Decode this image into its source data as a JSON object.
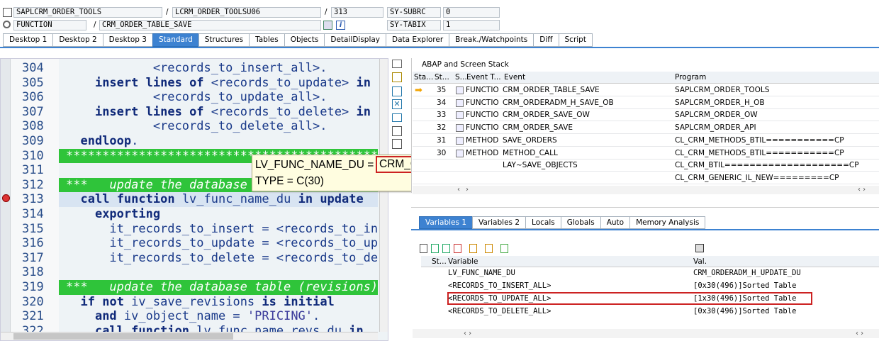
{
  "header": {
    "program_field": "SAPLCRM_ORDER_TOOLS",
    "include_sep": "/",
    "include_field": "LCRM_ORDER_TOOLSU06",
    "line_sep": "/",
    "line_field": "313",
    "sysvar1_label": "SY-SUBRC",
    "sysvar1_value": "0",
    "event_type": "FUNCTION",
    "event_sep": "/",
    "event_name": "CRM_ORDER_TABLE_SAVE",
    "sysvar2_label": "SY-TABIX",
    "sysvar2_value": "1"
  },
  "tabs": [
    "Desktop 1",
    "Desktop 2",
    "Desktop 3",
    "Standard",
    "Structures",
    "Tables",
    "Objects",
    "DetailDisplay",
    "Data Explorer",
    "Break./Watchpoints",
    "Diff",
    "Script"
  ],
  "active_tab": "Standard",
  "editor": {
    "lines": [
      {
        "n": "304",
        "text": "            <records_to_insert_all>."
      },
      {
        "n": "305",
        "text": "    insert lines of <records_to_update> in"
      },
      {
        "n": "306",
        "text": "            <records_to_update_all>."
      },
      {
        "n": "307",
        "text": "    insert lines of <records_to_delete> in"
      },
      {
        "n": "308",
        "text": "            <records_to_delete_all>."
      },
      {
        "n": "309",
        "text": "  endloop."
      },
      {
        "n": "310",
        "text": "*******************************************"
      },
      {
        "n": "311",
        "text": ""
      },
      {
        "n": "312",
        "text": "***   update the database"
      },
      {
        "n": "313",
        "text": "  call function lv_func_name_du in update"
      },
      {
        "n": "314",
        "text": "    exporting"
      },
      {
        "n": "315",
        "text": "      it_records_to_insert = <records_to_in"
      },
      {
        "n": "316",
        "text": "      it_records_to_update = <records_to_up"
      },
      {
        "n": "317",
        "text": "      it_records_to_delete = <records_to_de"
      },
      {
        "n": "318",
        "text": ""
      },
      {
        "n": "319",
        "text": "***   update the database table (revisions)"
      },
      {
        "n": "320",
        "text": "  if not iv_save_revisions is initial"
      },
      {
        "n": "321",
        "text": "    and iv_object_name = 'PRICING'."
      },
      {
        "n": "322",
        "text": "    call function lv_func_name_revs_du in"
      }
    ],
    "tooltip_line1": "LV_FUNC_NAME_DU = ",
    "tooltip_value": "CRM_ORDERADM_H_UPDATE_DU",
    "tooltip_line2": "TYPE  = C(30)"
  },
  "stack": {
    "title": "ABAP and Screen Stack",
    "headers": [
      "Sta...",
      "St...",
      "S...",
      "Event T...",
      "Event",
      "Program"
    ],
    "rows": [
      {
        "level": "35",
        "type": "FUNCTIO",
        "event": "CRM_ORDER_TABLE_SAVE",
        "program": "SAPLCRM_ORDER_TOOLS",
        "current": true
      },
      {
        "level": "34",
        "type": "FUNCTIO",
        "event": "CRM_ORDERADM_H_SAVE_OB",
        "program": "SAPLCRM_ORDER_H_OB",
        "current": false
      },
      {
        "level": "33",
        "type": "FUNCTIO",
        "event": "CRM_ORDER_SAVE_OW",
        "program": "SAPLCRM_ORDER_OW",
        "current": false
      },
      {
        "level": "32",
        "type": "FUNCTIO",
        "event": "CRM_ORDER_SAVE",
        "program": "SAPLCRM_ORDER_API",
        "current": false
      },
      {
        "level": "31",
        "type": "METHOD",
        "event": "SAVE_ORDERS",
        "program": "CL_CRM_METHODS_BTIL===========CP",
        "current": false
      },
      {
        "level": "30",
        "type": "METHOD",
        "event": "METHOD_CALL",
        "program": "CL_CRM_METHODS_BTIL===========CP",
        "current": false
      },
      {
        "level": "",
        "type": "",
        "event": "LAY~SAVE_OBJECTS",
        "program": "CL_CRM_BTIL====================CP",
        "current": false
      },
      {
        "level": "",
        "type": "",
        "event": "",
        "program": "CL_CRM_GENERIC_IL_NEW=========CP",
        "current": false
      }
    ]
  },
  "vars": {
    "tabs": [
      "Variables 1",
      "Variables 2",
      "Locals",
      "Globals",
      "Auto",
      "Memory Analysis"
    ],
    "active_tab": "Variables 1",
    "headers": [
      "St...",
      "Variable",
      "Val."
    ],
    "rows": [
      {
        "name": "LV_FUNC_NAME_DU",
        "value": "CRM_ORDERADM_H_UPDATE_DU"
      },
      {
        "name": "<RECORDS_TO_INSERT_ALL>",
        "value": "[0x30(496)]Sorted Table"
      },
      {
        "name": "<RECORDS_TO_UPDATE_ALL>",
        "value": "[1x30(496)]Sorted Table"
      },
      {
        "name": "<RECORDS_TO_DELETE_ALL>",
        "value": "[0x30(496)]Sorted Table"
      }
    ]
  },
  "colors": {
    "accent": "#3d82d1",
    "highlight_red": "#cc2222",
    "comment_green": "#2fc43a"
  }
}
